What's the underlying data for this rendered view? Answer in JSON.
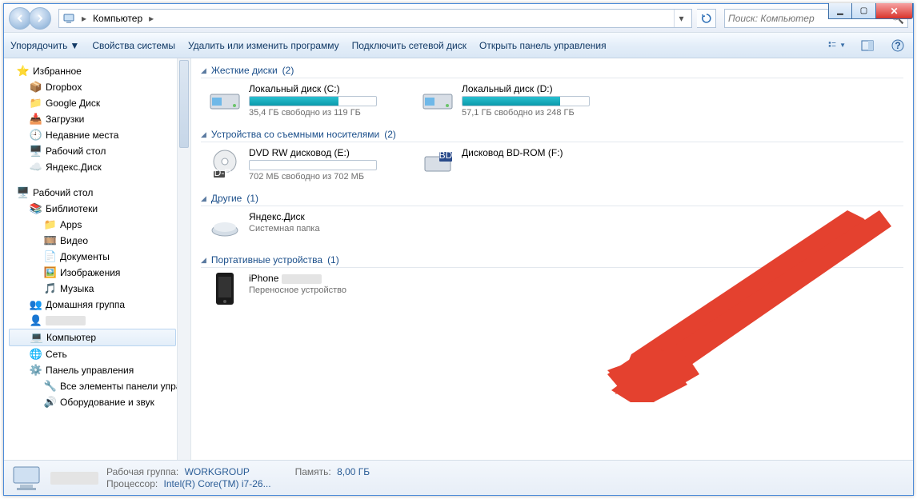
{
  "titlebar": {
    "min": "▁",
    "max": "▣",
    "close": "✕"
  },
  "nav": {
    "breadcrumb_icon": "computer",
    "breadcrumb": "Компьютер",
    "search_placeholder": "Поиск: Компьютер"
  },
  "toolbar": {
    "organize": "Упорядочить",
    "properties": "Свойства системы",
    "uninstall": "Удалить или изменить программу",
    "map_drive": "Подключить сетевой диск",
    "control_panel": "Открыть панель управления"
  },
  "sidebar": {
    "favorites": "Избранное",
    "fav_items": [
      "Dropbox",
      "Google Диск",
      "Загрузки",
      "Недавние места",
      "Рабочий стол",
      "Яндекс.Диск"
    ],
    "desktop": "Рабочий стол",
    "libraries": "Библиотеки",
    "lib_items": [
      "Apps",
      "Видео",
      "Документы",
      "Изображения",
      "Музыка"
    ],
    "homegroup": "Домашняя группа",
    "user_hidden": "",
    "computer": "Компьютер",
    "network": "Сеть",
    "control_panel": "Панель управления",
    "cp_all": "Все элементы панели управле",
    "cp_hw": "Оборудование и звук"
  },
  "groups": {
    "hdd": {
      "title": "Жесткие диски",
      "count": "(2)"
    },
    "removable": {
      "title": "Устройства со съемными носителями",
      "count": "(2)"
    },
    "other": {
      "title": "Другие",
      "count": "(1)"
    },
    "portable": {
      "title": "Портативные устройства",
      "count": "(1)"
    }
  },
  "drives": {
    "c": {
      "name": "Локальный диск (C:)",
      "sub": "35,4 ГБ свободно из 119 ГБ",
      "fill": 70
    },
    "d": {
      "name": "Локальный диск (D:)",
      "sub": "57,1 ГБ свободно из 248 ГБ",
      "fill": 77
    },
    "e": {
      "name": "DVD RW дисковод (E:)",
      "sub": "702 МБ свободно из 702 МБ",
      "fill": 0
    },
    "f": {
      "name": "Дисковод BD-ROM (F:)",
      "sub": ""
    },
    "yadisk": {
      "name": "Яндекс.Диск",
      "sub": "Системная папка"
    },
    "iphone": {
      "name": "iPhone",
      "sub": "Переносное устройство"
    }
  },
  "status": {
    "workgroup_label": "Рабочая группа:",
    "workgroup": "WORKGROUP",
    "cpu_label": "Процессор:",
    "cpu": "Intel(R) Core(TM) i7-26...",
    "mem_label": "Память:",
    "mem": "8,00 ГБ"
  }
}
